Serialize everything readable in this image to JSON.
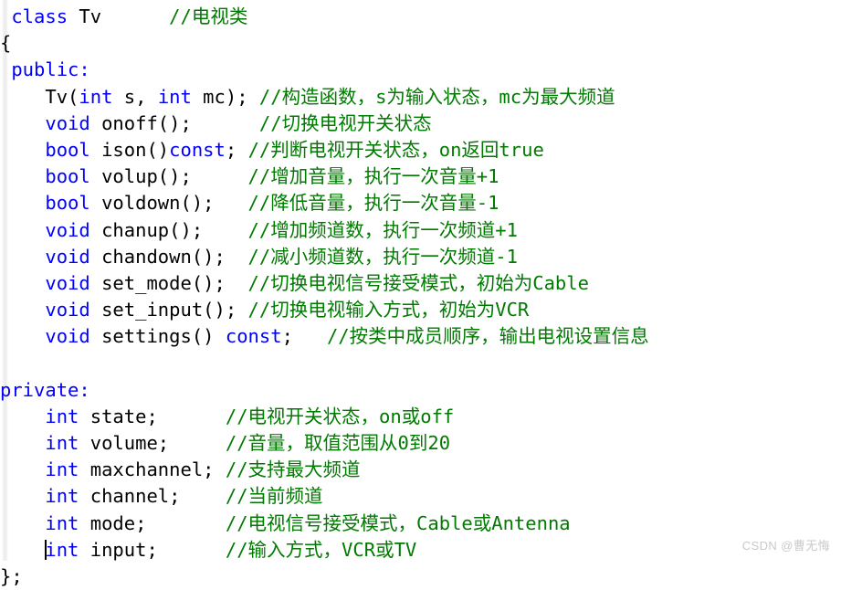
{
  "editor": {
    "language": "C++",
    "background_color": "#ffffff",
    "colors": {
      "keyword": "#0000ff",
      "identifier": "#000000",
      "comment": "#007a00",
      "gutter": "#ebebeb",
      "watermark": "#c9c9c9"
    },
    "caret": {
      "visible": true,
      "line_index": 20,
      "before_token": "int input;"
    }
  },
  "watermark": {
    "text": "CSDN @曹无悔"
  },
  "code": {
    "lines": [
      {
        "index": 1,
        "tokens": [
          {
            "t": " ",
            "c": "id"
          },
          {
            "t": "class",
            "c": "kw"
          },
          {
            "t": " Tv",
            "c": "id"
          },
          {
            "t": "      ",
            "c": "id"
          },
          {
            "t": "//电视类",
            "c": "cmt"
          }
        ]
      },
      {
        "index": 2,
        "tokens": [
          {
            "t": "{",
            "c": "id"
          }
        ]
      },
      {
        "index": 3,
        "tokens": [
          {
            "t": " ",
            "c": "id"
          },
          {
            "t": "public:",
            "c": "kw"
          }
        ]
      },
      {
        "index": 4,
        "tokens": [
          {
            "t": "    Tv(",
            "c": "id"
          },
          {
            "t": "int",
            "c": "kw"
          },
          {
            "t": " s, ",
            "c": "id"
          },
          {
            "t": "int",
            "c": "kw"
          },
          {
            "t": " mc); ",
            "c": "id"
          },
          {
            "t": "//构造函数，s为输入状态，mc为最大频道",
            "c": "cmt"
          }
        ]
      },
      {
        "index": 5,
        "tokens": [
          {
            "t": "    ",
            "c": "id"
          },
          {
            "t": "void",
            "c": "kw"
          },
          {
            "t": " onoff();      ",
            "c": "id"
          },
          {
            "t": "//切换电视开关状态",
            "c": "cmt"
          }
        ]
      },
      {
        "index": 6,
        "tokens": [
          {
            "t": "    ",
            "c": "id"
          },
          {
            "t": "bool",
            "c": "kw"
          },
          {
            "t": " ison()",
            "c": "id"
          },
          {
            "t": "const",
            "c": "kw"
          },
          {
            "t": "; ",
            "c": "id"
          },
          {
            "t": "//判断电视开关状态，on返回true",
            "c": "cmt"
          }
        ]
      },
      {
        "index": 7,
        "tokens": [
          {
            "t": "    ",
            "c": "id"
          },
          {
            "t": "bool",
            "c": "kw"
          },
          {
            "t": " volup();     ",
            "c": "id"
          },
          {
            "t": "//增加音量，执行一次音量+1",
            "c": "cmt"
          }
        ]
      },
      {
        "index": 8,
        "tokens": [
          {
            "t": "    ",
            "c": "id"
          },
          {
            "t": "bool",
            "c": "kw"
          },
          {
            "t": " voldown();   ",
            "c": "id"
          },
          {
            "t": "//降低音量，执行一次音量-1",
            "c": "cmt"
          }
        ]
      },
      {
        "index": 9,
        "tokens": [
          {
            "t": "    ",
            "c": "id"
          },
          {
            "t": "void",
            "c": "kw"
          },
          {
            "t": " chanup();    ",
            "c": "id"
          },
          {
            "t": "//增加频道数，执行一次频道+1",
            "c": "cmt"
          }
        ]
      },
      {
        "index": 10,
        "tokens": [
          {
            "t": "    ",
            "c": "id"
          },
          {
            "t": "void",
            "c": "kw"
          },
          {
            "t": " chandown();  ",
            "c": "id"
          },
          {
            "t": "//减小频道数，执行一次频道-1",
            "c": "cmt"
          }
        ]
      },
      {
        "index": 11,
        "tokens": [
          {
            "t": "    ",
            "c": "id"
          },
          {
            "t": "void",
            "c": "kw"
          },
          {
            "t": " set_mode();  ",
            "c": "id"
          },
          {
            "t": "//切换电视信号接受模式，初始为Cable",
            "c": "cmt"
          }
        ]
      },
      {
        "index": 12,
        "tokens": [
          {
            "t": "    ",
            "c": "id"
          },
          {
            "t": "void",
            "c": "kw"
          },
          {
            "t": " set_input(); ",
            "c": "id"
          },
          {
            "t": "//切换电视输入方式，初始为VCR",
            "c": "cmt"
          }
        ]
      },
      {
        "index": 13,
        "tokens": [
          {
            "t": "    ",
            "c": "id"
          },
          {
            "t": "void",
            "c": "kw"
          },
          {
            "t": " settings() ",
            "c": "id"
          },
          {
            "t": "const",
            "c": "kw"
          },
          {
            "t": ";   ",
            "c": "id"
          },
          {
            "t": "//按类中成员顺序，输出电视设置信息",
            "c": "cmt"
          }
        ]
      },
      {
        "index": 14,
        "tokens": []
      },
      {
        "index": 15,
        "tokens": [
          {
            "t": "private:",
            "c": "kw"
          }
        ]
      },
      {
        "index": 16,
        "tokens": [
          {
            "t": "    ",
            "c": "id"
          },
          {
            "t": "int",
            "c": "kw"
          },
          {
            "t": " state;      ",
            "c": "id"
          },
          {
            "t": "//电视开关状态，on或off",
            "c": "cmt"
          }
        ]
      },
      {
        "index": 17,
        "tokens": [
          {
            "t": "    ",
            "c": "id"
          },
          {
            "t": "int",
            "c": "kw"
          },
          {
            "t": " volume;     ",
            "c": "id"
          },
          {
            "t": "//音量，取值范围从0到20",
            "c": "cmt"
          }
        ]
      },
      {
        "index": 18,
        "tokens": [
          {
            "t": "    ",
            "c": "id"
          },
          {
            "t": "int",
            "c": "kw"
          },
          {
            "t": " maxchannel; ",
            "c": "id"
          },
          {
            "t": "//支持最大频道",
            "c": "cmt"
          }
        ]
      },
      {
        "index": 19,
        "tokens": [
          {
            "t": "    ",
            "c": "id"
          },
          {
            "t": "int",
            "c": "kw"
          },
          {
            "t": " channel;    ",
            "c": "id"
          },
          {
            "t": "//当前频道",
            "c": "cmt"
          }
        ]
      },
      {
        "index": 20,
        "tokens": [
          {
            "t": "    ",
            "c": "id"
          },
          {
            "t": "int",
            "c": "kw"
          },
          {
            "t": " mode;       ",
            "c": "id"
          },
          {
            "t": "//电视信号接受模式，Cable或Antenna",
            "c": "cmt"
          }
        ]
      },
      {
        "index": 21,
        "caret_at": 4,
        "tokens": [
          {
            "t": "    ",
            "c": "id"
          },
          {
            "t": "int",
            "c": "kw"
          },
          {
            "t": " input;      ",
            "c": "id"
          },
          {
            "t": "//输入方式，VCR或TV",
            "c": "cmt"
          }
        ]
      },
      {
        "index": 22,
        "tokens": [
          {
            "t": "};",
            "c": "id"
          }
        ]
      }
    ]
  }
}
